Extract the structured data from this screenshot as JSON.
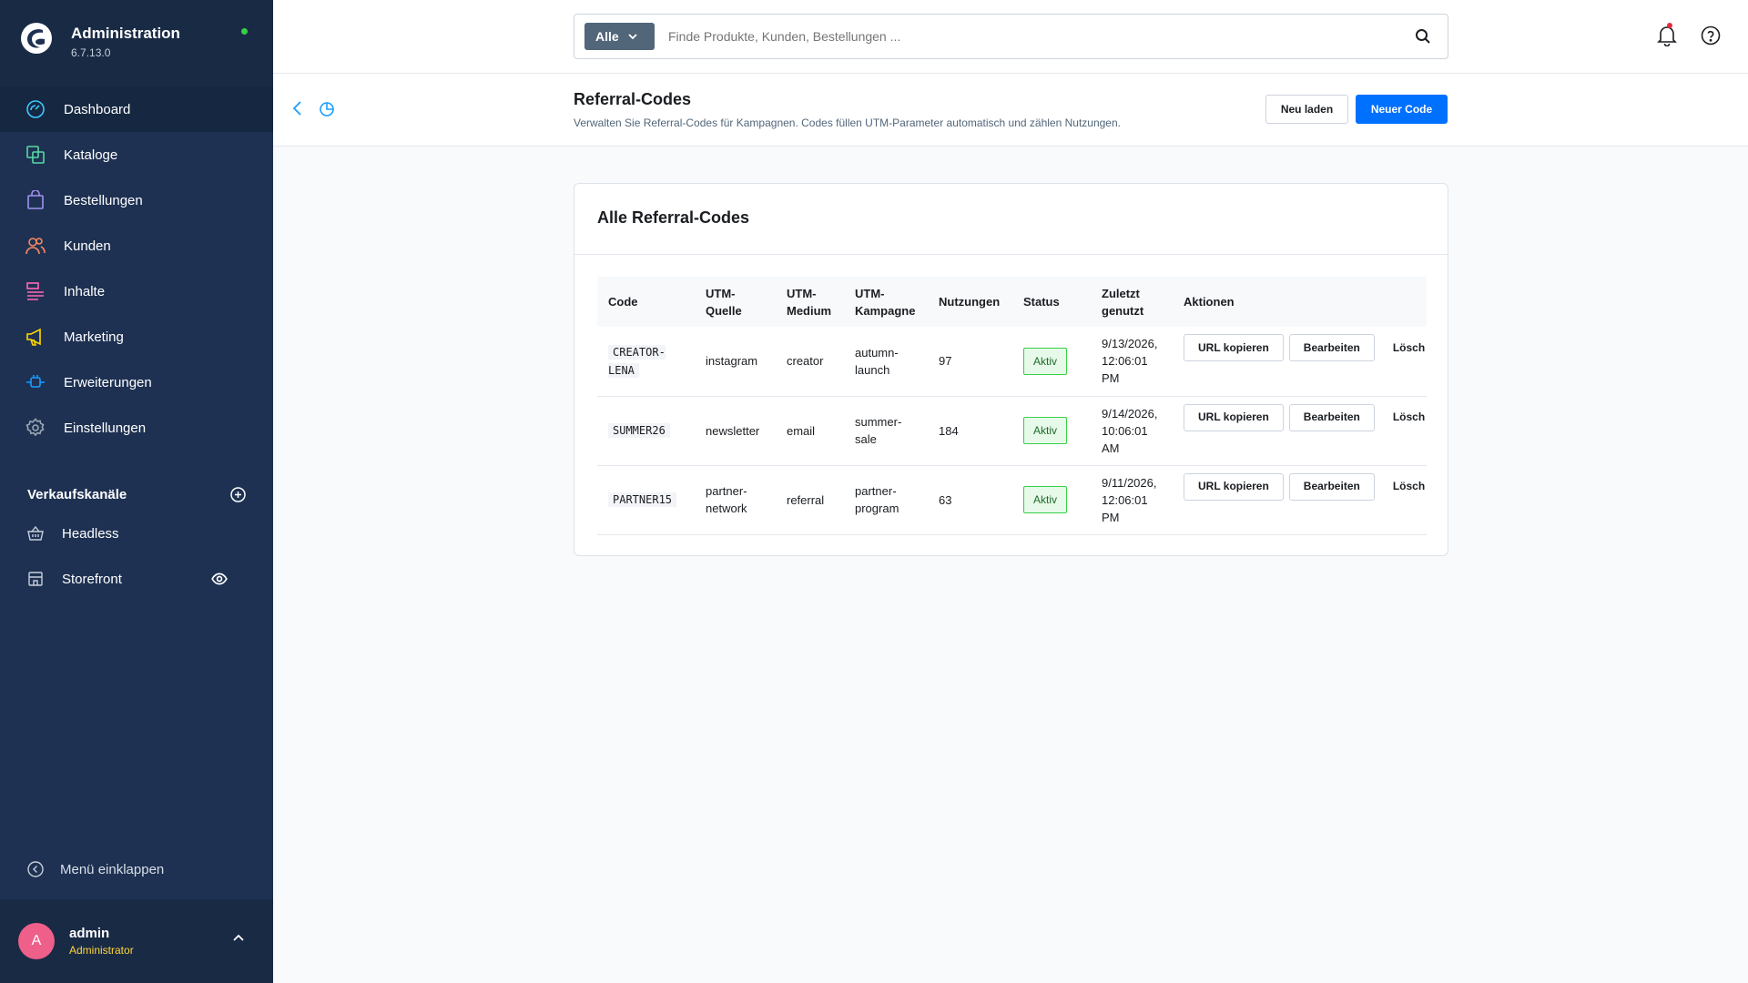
{
  "sidebar": {
    "title": "Administration",
    "version": "6.7.13.0",
    "nav": [
      {
        "label": "Dashboard",
        "icon": "dashboard-icon",
        "color": "#3ec6ff"
      },
      {
        "label": "Kataloge",
        "icon": "catalog-icon",
        "color": "#57d9a3"
      },
      {
        "label": "Bestellungen",
        "icon": "bag-icon",
        "color": "#a092f0"
      },
      {
        "label": "Kunden",
        "icon": "users-icon",
        "color": "#f88962"
      },
      {
        "label": "Inhalte",
        "icon": "content-icon",
        "color": "#ff68b4"
      },
      {
        "label": "Marketing",
        "icon": "megaphone-icon",
        "color": "#ffd700"
      },
      {
        "label": "Erweiterungen",
        "icon": "plug-icon",
        "color": "#189eff"
      },
      {
        "label": "Einstellungen",
        "icon": "gear-icon",
        "color": "#9aa8b5"
      }
    ],
    "sales_channels_label": "Verkaufskanäle",
    "channels": [
      {
        "label": "Headless"
      },
      {
        "label": "Storefront"
      }
    ],
    "collapse_label": "Menü einklappen",
    "user": {
      "initial": "A",
      "name": "admin",
      "role": "Administrator"
    }
  },
  "topbar": {
    "search_type": "Alle",
    "search_placeholder": "Finde Produkte, Kunden, Bestellungen ..."
  },
  "page": {
    "title": "Referral-Codes",
    "subtitle": "Verwalten Sie Referral-Codes für Kampagnen. Codes füllen UTM-Parameter automatisch und zählen Nutzungen.",
    "reload_label": "Neu laden",
    "new_label": "Neuer Code"
  },
  "card": {
    "title": "Alle Referral-Codes",
    "columns": {
      "code": "Code",
      "source": "UTM-Quelle",
      "medium": "UTM-Medium",
      "campaign": "UTM-Kampagne",
      "uses": "Nutzungen",
      "status": "Status",
      "last_used": "Zuletzt genutzt",
      "actions": "Aktionen"
    },
    "action_labels": {
      "copy": "URL kopieren",
      "edit": "Bearbeiten",
      "delete": "Lösch"
    },
    "rows": [
      {
        "code": "CREATOR-LENA",
        "source": "instagram",
        "medium": "creator",
        "campaign": "autumn-launch",
        "uses": "97",
        "status": "Aktiv",
        "last_used": "9/13/2026, 12:06:01 PM"
      },
      {
        "code": "SUMMER26",
        "source": "newsletter",
        "medium": "email",
        "campaign": "summer-sale",
        "uses": "184",
        "status": "Aktiv",
        "last_used": "9/14/2026, 10:06:01 AM"
      },
      {
        "code": "PARTNER15",
        "source": "partner-network",
        "medium": "referral",
        "campaign": "partner-program",
        "uses": "63",
        "status": "Aktiv",
        "last_used": "9/11/2026, 12:06:01 PM"
      }
    ]
  },
  "colors": {
    "sidebar_bg": "#1e3152",
    "primary": "#0070ff",
    "status_active": "#37d046",
    "avatar": "#ee5f8a",
    "role": "#ffd53a"
  }
}
